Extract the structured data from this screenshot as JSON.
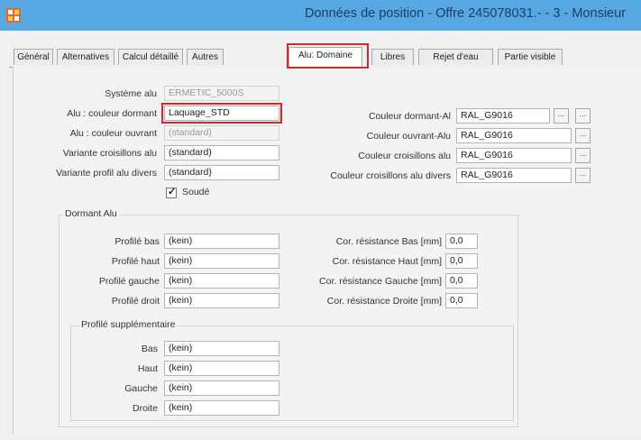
{
  "window": {
    "title": "Données de position - Offre 245078031.- - 3 - Monsieur"
  },
  "tabs": [
    {
      "label": "Général",
      "active": false
    },
    {
      "label": "Alternatives",
      "active": false
    },
    {
      "label": "Calcul détaillé",
      "active": false
    },
    {
      "label": "Autres",
      "active": false
    },
    {
      "label": "Alu: Domaine",
      "active": true
    },
    {
      "label": "Libres",
      "active": false
    },
    {
      "label": "Rejet d'eau",
      "active": false
    },
    {
      "label": "Partie visible",
      "active": false
    }
  ],
  "main": {
    "systeme_alu": {
      "label": "Système alu",
      "value": "ERMETIC_5000S"
    },
    "couleur_dormant": {
      "label": "Alu : couleur dormant",
      "value": "Laquage_STD"
    },
    "couleur_ouvrant": {
      "label": "Alu : couleur ouvrant",
      "value": "(standard)"
    },
    "variante_croisillons": {
      "label": "Variante croisillons alu",
      "value": "(standard)"
    },
    "variante_profil": {
      "label": "Variante profil alu divers",
      "value": "(standard)"
    },
    "soude": {
      "label": "Soudé",
      "checked": true
    },
    "couleur_dormant_al": {
      "label": "Couleur dormant-Al",
      "value": "RAL_G9016",
      "button": "..."
    },
    "couleur_ouvrant_alu": {
      "label": "Couleur ouvrant-Alu",
      "value": "RAL_G9016",
      "button": "..."
    },
    "couleur_croisillons": {
      "label": "Couleur croisillons alu",
      "value": "RAL_G9016",
      "button": "..."
    },
    "couleur_croisillons_divers": {
      "label": "Couleur croisillons alu divers",
      "value": "RAL_G9016",
      "button": "..."
    }
  },
  "dormant_alu": {
    "title": "Dormant Alu",
    "profile_rows": [
      {
        "label": "Profilé bas",
        "value": "(kein)"
      },
      {
        "label": "Profilé haut",
        "value": "(kein)"
      },
      {
        "label": "Profilé gauche",
        "value": "(kein)"
      },
      {
        "label": "Profilé droit",
        "value": "(kein)"
      }
    ],
    "resistance_rows": [
      {
        "label": "Cor. résistance Bas [mm]",
        "value": "0,0"
      },
      {
        "label": "Cor. résistance Haut [mm]",
        "value": "0,0"
      },
      {
        "label": "Cor. résistance Gauche [mm]",
        "value": "0,0"
      },
      {
        "label": "Cor. résistance Droite [mm]",
        "value": "0,0"
      }
    ]
  },
  "profile_supplementaire": {
    "title": "Profilé supplémentaire",
    "rows": [
      {
        "label": "Bas",
        "value": "(kein)"
      },
      {
        "label": "Haut",
        "value": "(kein)"
      },
      {
        "label": "Gauche",
        "value": "(kein)"
      },
      {
        "label": "Droite",
        "value": "(kein)"
      }
    ]
  },
  "colors": {
    "titlebar": "#57a7e2",
    "highlight": "#d6262e"
  }
}
